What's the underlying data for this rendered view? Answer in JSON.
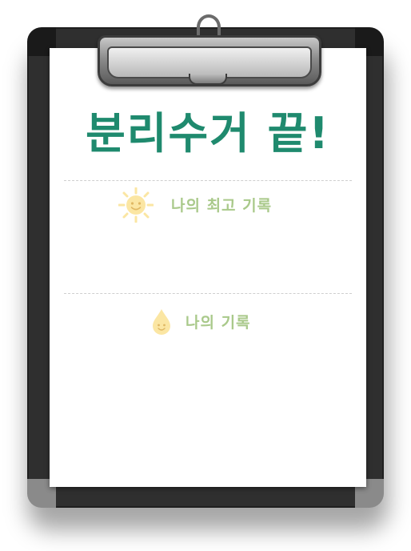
{
  "title": "분리수거 끝!",
  "sections": [
    {
      "label": "나의 최고 기록",
      "icon": "sun-icon"
    },
    {
      "label": "나의 기록",
      "icon": "water-drop-icon"
    }
  ],
  "colors": {
    "title": "#1f8a6e",
    "label": "#a9c98a",
    "board": "#2f2f2f",
    "icon_yellow": "#fbe6a3"
  }
}
